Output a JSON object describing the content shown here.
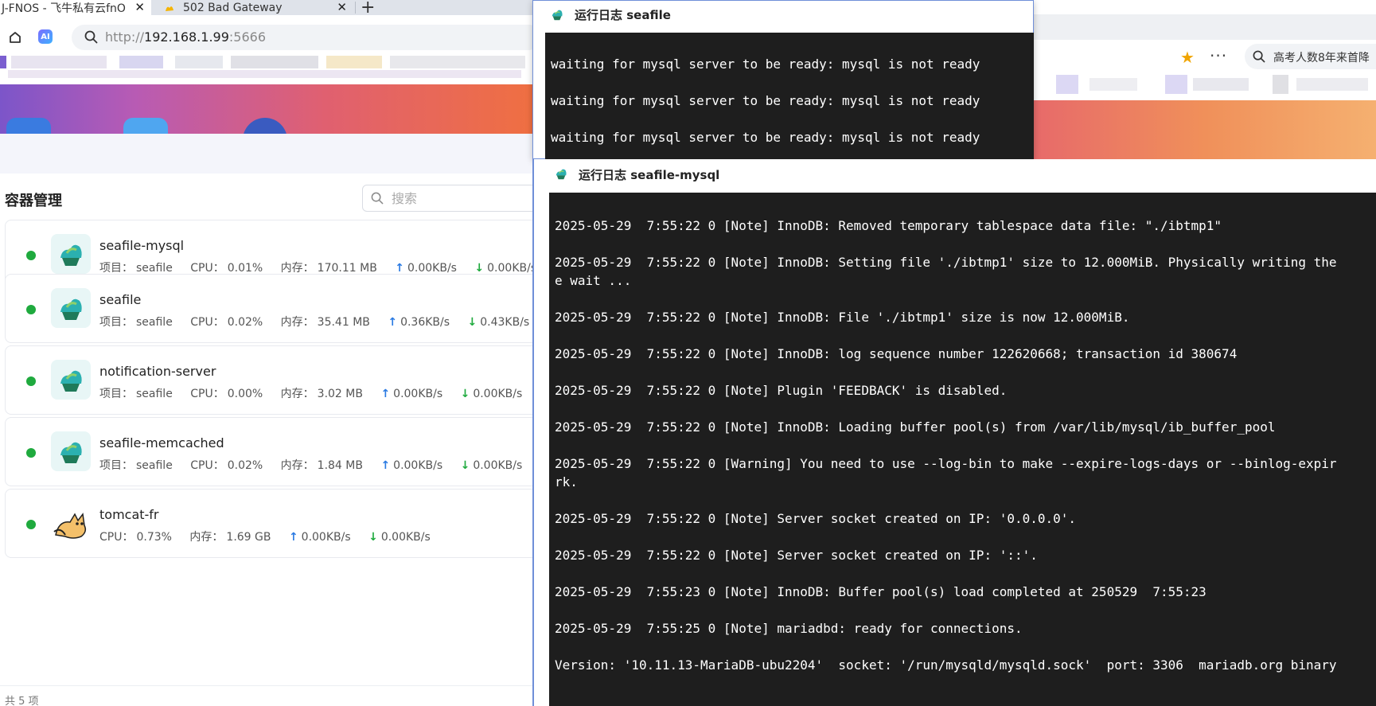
{
  "browser": {
    "tabs": [
      {
        "label": "J-FNOS - 飞牛私有云fnO"
      },
      {
        "label": "502 Bad Gateway"
      }
    ],
    "address": {
      "prefix": "http://",
      "host": "192.168.1.99",
      "port": ":5666"
    },
    "new_tab_label": "+",
    "close_label": "✕"
  },
  "right_browser": {
    "search_text": "高考人数8年来首降"
  },
  "container_panel": {
    "title": "容器管理",
    "search_placeholder": "搜索",
    "footer": "共 5 项",
    "containers": [
      {
        "name": "seafile-mysql",
        "project_label": "项目：",
        "project": "seafile",
        "cpu_label": "CPU：",
        "cpu": "0.01%",
        "mem_label": "内存：",
        "mem": "170.11 MB",
        "up": "0.00KB/s",
        "down": "0.00KB/s",
        "status_color": "#1faa3e"
      },
      {
        "name": "seafile",
        "project_label": "项目：",
        "project": "seafile",
        "cpu_label": "CPU：",
        "cpu": "0.02%",
        "mem_label": "内存：",
        "mem": "35.41 MB",
        "up": "0.36KB/s",
        "down": "0.43KB/s",
        "status_color": "#1faa3e"
      },
      {
        "name": "notification-server",
        "project_label": "项目：",
        "project": "seafile",
        "cpu_label": "CPU：",
        "cpu": "0.00%",
        "mem_label": "内存：",
        "mem": "3.02 MB",
        "up": "0.00KB/s",
        "down": "0.00KB/s",
        "status_color": "#1faa3e"
      },
      {
        "name": "seafile-memcached",
        "project_label": "项目：",
        "project": "seafile",
        "cpu_label": "CPU：",
        "cpu": "0.02%",
        "mem_label": "内存：",
        "mem": "1.84 MB",
        "up": "0.00KB/s",
        "down": "0.00KB/s",
        "status_color": "#1faa3e"
      },
      {
        "name": "tomcat-fr",
        "cpu_label": "CPU：",
        "cpu": "0.73%",
        "mem_label": "内存：",
        "mem": "1.69 GB",
        "up": "0.00KB/s",
        "down": "0.00KB/s",
        "status_color": "#1faa3e"
      }
    ]
  },
  "log_seafile": {
    "title": "运行日志 seafile",
    "lines": [
      "waiting for mysql server to be ready: mysql is not ready",
      "waiting for mysql server to be ready: mysql is not ready",
      "waiting for mysql server to be ready: mysql is not ready"
    ]
  },
  "log_mysql": {
    "title": "运行日志 seafile-mysql",
    "lines": [
      "2025-05-29  7:55:22 0 [Note] InnoDB: Removed temporary tablespace data file: \"./ibtmp1\"",
      "2025-05-29  7:55:22 0 [Note] InnoDB: Setting file './ibtmp1' size to 12.000MiB. Physically writing the",
      "e wait ...",
      "2025-05-29  7:55:22 0 [Note] InnoDB: File './ibtmp1' size is now 12.000MiB.",
      "2025-05-29  7:55:22 0 [Note] InnoDB: log sequence number 122620668; transaction id 380674",
      "2025-05-29  7:55:22 0 [Note] Plugin 'FEEDBACK' is disabled.",
      "2025-05-29  7:55:22 0 [Note] InnoDB: Loading buffer pool(s) from /var/lib/mysql/ib_buffer_pool",
      "2025-05-29  7:55:22 0 [Warning] You need to use --log-bin to make --expire-logs-days or --binlog-expir",
      "rk.",
      "2025-05-29  7:55:22 0 [Note] Server socket created on IP: '0.0.0.0'.",
      "2025-05-29  7:55:22 0 [Note] Server socket created on IP: '::'.",
      "2025-05-29  7:55:23 0 [Note] InnoDB: Buffer pool(s) load completed at 250529  7:55:23",
      "2025-05-29  7:55:25 0 [Note] mariadbd: ready for connections.",
      "Version: '10.11.13-MariaDB-ubu2204'  socket: '/run/mysqld/mysqld.sock'  port: 3306  mariadb.org binary"
    ]
  }
}
